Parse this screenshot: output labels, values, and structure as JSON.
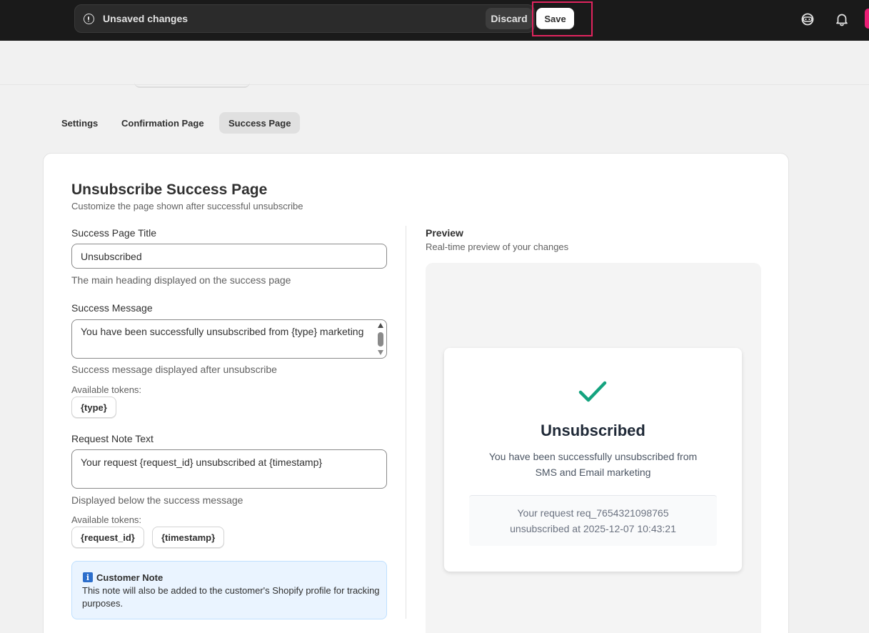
{
  "topbar": {
    "unsaved_text": "Unsaved changes",
    "discard_label": "Discard",
    "save_label": "Save"
  },
  "tabs": [
    {
      "label": "Settings",
      "active": false
    },
    {
      "label": "Confirmation Page",
      "active": false
    },
    {
      "label": "Success Page",
      "active": true
    }
  ],
  "card": {
    "title": "Unsubscribe Success Page",
    "subtitle": "Customize the page shown after successful unsubscribe"
  },
  "form": {
    "title_label": "Success Page Title",
    "title_value": "Unsubscribed",
    "title_help": "The main heading displayed on the success page",
    "message_label": "Success Message",
    "message_value": "You have been successfully unsubscribed from {type} marketing",
    "message_help": "Success message displayed after unsubscribe",
    "message_tokens_label": "Available tokens:",
    "message_tokens": [
      "{type}"
    ],
    "note_label": "Request Note Text",
    "note_value": "Your request {request_id} unsubscribed at {timestamp}",
    "note_help": "Displayed below the success message",
    "note_tokens_label": "Available tokens:",
    "note_tokens": [
      "{request_id}",
      "{timestamp}"
    ]
  },
  "customer_note": {
    "icon": "info-icon",
    "title": "Customer Note",
    "text": "This note will also be added to the customer's Shopify profile for tracking purposes."
  },
  "preview": {
    "title": "Preview",
    "subtitle": "Real-time preview of your changes",
    "heading": "Unsubscribed",
    "message_line1": "You have been successfully unsubscribed from",
    "message_line2": "SMS and Email marketing",
    "note_line1": "Your request req_7654321098765",
    "note_line2": "unsubscribed at 2025-12-07 10:43:21",
    "check_color": "#14a37f"
  },
  "colors": {
    "topbar": "#1a1a1a",
    "highlight": "#e0245e",
    "brand_pink": "#e91e75"
  }
}
